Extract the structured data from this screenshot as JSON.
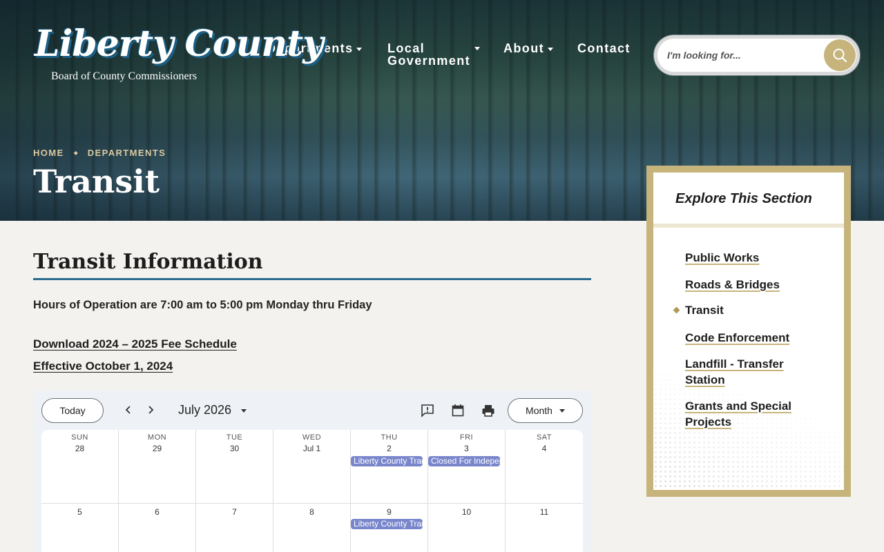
{
  "header": {
    "logo_script": "Liberty County",
    "logo_sub": "Board of County Commissioners",
    "nav": [
      {
        "label": "Departments",
        "has_dropdown": true
      },
      {
        "label_line1": "Local",
        "label_line2": "Government",
        "has_dropdown": true
      },
      {
        "label": "About",
        "has_dropdown": true
      },
      {
        "label": "Contact",
        "has_dropdown": false
      }
    ],
    "search": {
      "placeholder": "I'm looking for...",
      "icon": "search-icon"
    }
  },
  "breadcrumb": [
    "HOME",
    "DEPARTMENTS"
  ],
  "page_title": "Transit",
  "main": {
    "heading": "Transit Information",
    "hours": "Hours of Operation are 7:00 am to 5:00 pm Monday thru Friday",
    "links": [
      "Download 2024 – 2025 Fee Schedule",
      "Effective October 1, 2024"
    ]
  },
  "calendar": {
    "today_label": "Today",
    "month_label": "July 2026",
    "view_label": "Month",
    "days_of_week": [
      "SUN",
      "MON",
      "TUE",
      "WED",
      "THU",
      "FRI",
      "SAT"
    ],
    "week1": [
      "28",
      "29",
      "30",
      "Jul 1",
      "2",
      "3",
      "4"
    ],
    "week2": [
      "5",
      "6",
      "7",
      "8",
      "9",
      "10",
      "11"
    ],
    "events": {
      "thu2": "Liberty County Transit",
      "fri3": "Closed For Independence Day",
      "thu9": "Liberty County Transit"
    },
    "event_color": "#7986cb"
  },
  "sidebar": {
    "title": "Explore This Section",
    "items": [
      {
        "label": "Public Works"
      },
      {
        "label": "Roads & Bridges"
      },
      {
        "label": "Transit",
        "active": true
      },
      {
        "label": "Code Enforcement"
      },
      {
        "label": "Landfill - Transfer Station"
      },
      {
        "label": "Grants and Special Projects"
      }
    ]
  },
  "colors": {
    "accent_gold": "#c7b47c",
    "accent_blue": "#2b6b8f"
  }
}
